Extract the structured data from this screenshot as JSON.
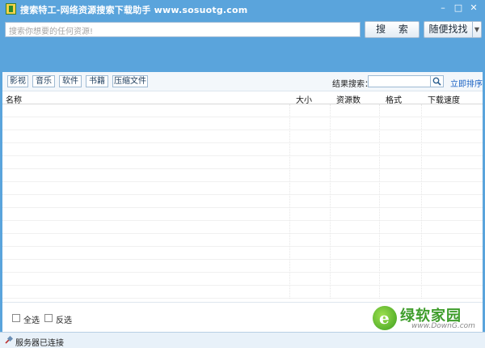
{
  "window": {
    "title": "搜索特工-网络资源搜索下载助手  www.sosuotg.com",
    "controls": {
      "minimize": "–",
      "maximize": "□",
      "close": "✕"
    }
  },
  "search": {
    "placeholder": "搜索你想要的任何资源!",
    "value": "",
    "search_button": "搜 索",
    "random_button": "随便找找",
    "random_dropdown_icon": "chevron-down-icon"
  },
  "categories": [
    "影视",
    "音乐",
    "软件",
    "书籍",
    "压缩文件"
  ],
  "result_filter": {
    "label": "结果搜索：",
    "value": "",
    "search_icon": "magnifier-icon",
    "sort_link": "立即排序"
  },
  "table": {
    "columns": [
      "名称",
      "大小",
      "资源数",
      "格式",
      "下载速度"
    ],
    "rows": []
  },
  "bottom": {
    "select_all": "全选",
    "invert_select": "反选"
  },
  "watermark": {
    "name": "绿软家园",
    "url": "www.DownG.com"
  },
  "status": {
    "icon": "plug-icon",
    "text": "服务器已连接"
  },
  "colors": {
    "frame": "#5aa4dc",
    "link": "#1a62c4",
    "logo_green": "#3e9d2b"
  }
}
